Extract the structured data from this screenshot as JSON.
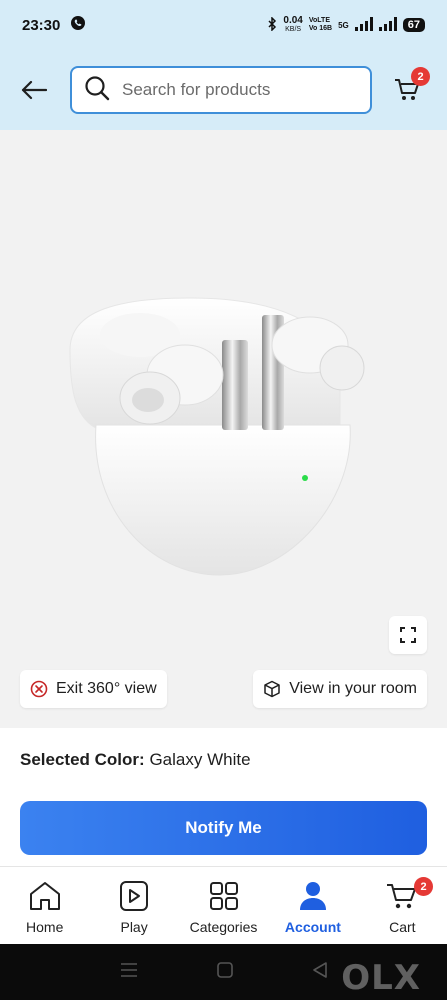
{
  "status_bar": {
    "time": "23:30",
    "net_speed": "0.04",
    "net_unit": "KB/S",
    "volte_top": "VoLTE",
    "volte_bottom": "Vo 16B",
    "network": "5G",
    "battery": "67"
  },
  "header": {
    "search_placeholder": "Search for products",
    "cart_count": "2"
  },
  "viewer": {
    "exit_label": "Exit 360° view",
    "room_label": "View in your room"
  },
  "product": {
    "selected_color_label": "Selected Color:",
    "selected_color_value": "Galaxy White",
    "notify_label": "Notify Me"
  },
  "bottom_nav": {
    "items": [
      {
        "label": "Home",
        "icon": "home-icon"
      },
      {
        "label": "Play",
        "icon": "play-icon"
      },
      {
        "label": "Categories",
        "icon": "categories-icon"
      },
      {
        "label": "Account",
        "icon": "account-icon"
      },
      {
        "label": "Cart",
        "icon": "cart-icon"
      }
    ],
    "active": "Account",
    "cart_count": "2"
  },
  "watermark": "OLX",
  "colors": {
    "header_bg": "#d6ecf8",
    "accent": "#1f5fe0",
    "badge": "#e53935"
  }
}
